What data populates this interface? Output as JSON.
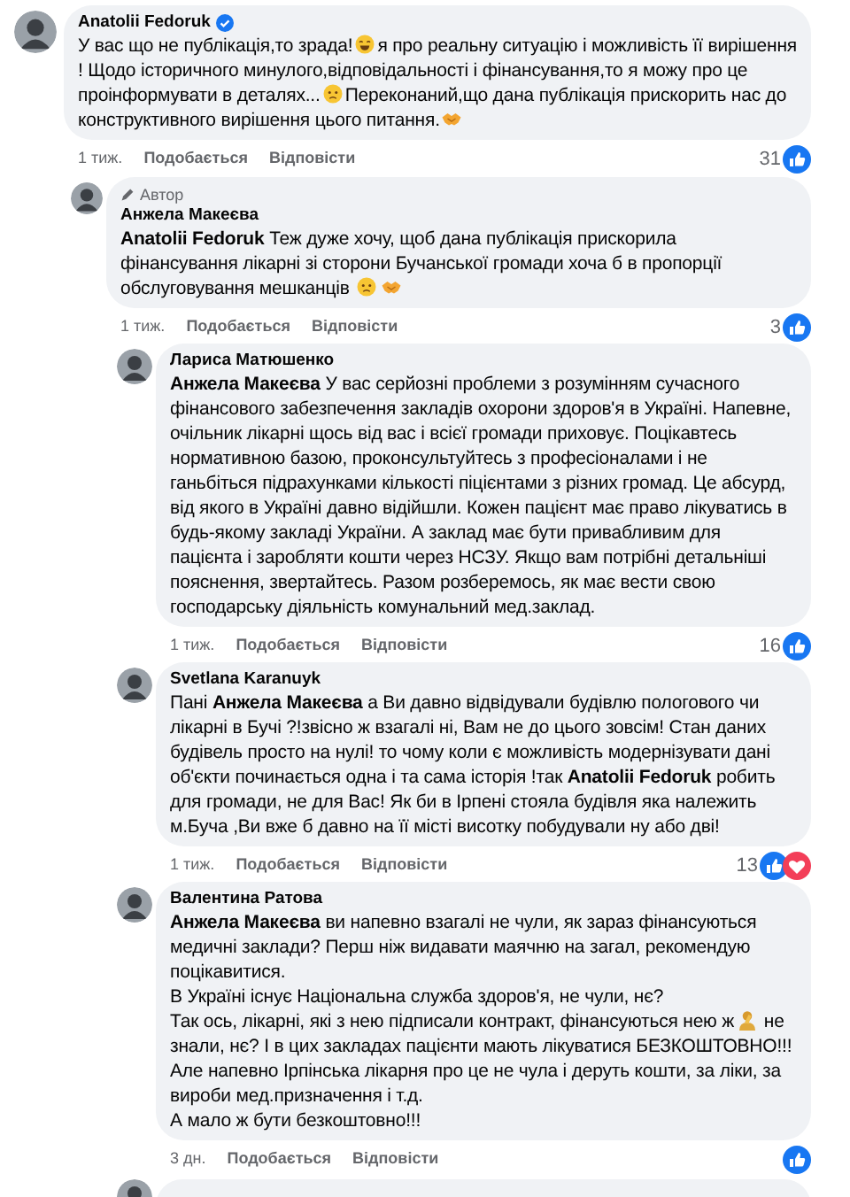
{
  "comments": [
    {
      "author": "Anatolii Fedoruk",
      "verified": true,
      "body": [
        {
          "kind": "text",
          "text": "У вас що не публікація,то зрада!"
        },
        {
          "kind": "grin"
        },
        {
          "kind": "text",
          "text": "я про реальну ситуацію і можливість її вирішення ! Щодо історичного минулого,відповідальності і фінансування,то я можу про це проінформувати в деталях..."
        },
        {
          "kind": "sad"
        },
        {
          "kind": "text",
          "text": "Переконаний,що дана публікація прискорить нас до конструктивного вирішення цього питання."
        },
        {
          "kind": "handshake"
        }
      ],
      "time": "1 тиж.",
      "like_label": "Подобається",
      "reply_label": "Відповісти",
      "reaction_count": "31",
      "reactions": [
        {
          "kind": "like"
        }
      ],
      "children": [
        {
          "author": "Анжела Макеєва",
          "badge": {
            "kind": "author",
            "text": "Автор"
          },
          "body": [
            {
              "kind": "mention",
              "text": "Anatolii Fedoruk"
            },
            {
              "kind": "text",
              "text": " Теж дуже хочу, щоб дана публікація прискорила фінансування лікарні зі сторони Бучанської громади хоча б в пропорції обслуговування мешканців "
            },
            {
              "kind": "sad"
            },
            {
              "kind": "handshake"
            }
          ],
          "time": "1 тиж.",
          "like_label": "Подобається",
          "reply_label": "Відповісти",
          "reaction_count": "3",
          "reactions": [
            {
              "kind": "like"
            }
          ],
          "children": [
            {
              "author": "Лариса Матюшенко",
              "body": [
                {
                  "kind": "mention",
                  "text": "Анжела Макеєва"
                },
                {
                  "kind": "text",
                  "text": " У вас серйозні проблеми з розумінням сучасного фінансового забезпечення закладів охорони здоров'я в Україні. Напевне, очільник лікарні щось від вас і всієї громади приховує. Поцікавтесь нормативною базою, проконсультуйтесь з професіоналами і не ганьбіться підрахунками кількості піцієнтами з різних громад. Це абсурд, від якого в Україні давно відійшли. Кожен пацієнт має право лікуватись в будь-якому закладі України. А заклад має бути привабливим для пацієнта і заробляти кошти через НСЗУ. Якщо вам потрібні детальніші пояснення, звертайтесь. Разом розберемось, як має вести свою господарську діяльність комунальний мед.заклад."
                }
              ],
              "time": "1 тиж.",
              "like_label": "Подобається",
              "reply_label": "Відповісти",
              "reaction_count": "16",
              "reactions": [
                {
                  "kind": "like"
                }
              ]
            },
            {
              "author": "Svetlana Karanuyk",
              "body": [
                {
                  "kind": "text",
                  "text": "Пані "
                },
                {
                  "kind": "mention",
                  "text": "Анжела Макеєва"
                },
                {
                  "kind": "text",
                  "text": " а Ви давно відвідували будівлю пологового чи лікарні в Бучі ?!звісно ж взагалі ні, Вам не до цього зовсім! Стан даних будівель просто на нулі! то чому коли є можливість модернізувати дані об'єкти починається одна і та сама історія !так "
                },
                {
                  "kind": "mention",
                  "text": "Anatolii Fedoruk"
                },
                {
                  "kind": "text",
                  "text": " робить для громади, не для Вас! Як би в Ірпені стояла будівля яка належить м.Буча ,Ви вже б давно на її місті висотку побудували ну або дві!"
                }
              ],
              "time": "1 тиж.",
              "like_label": "Подобається",
              "reply_label": "Відповісти",
              "reaction_count": "13",
              "reactions": [
                {
                  "kind": "like"
                },
                {
                  "kind": "love"
                }
              ]
            },
            {
              "author": "Валентина Ратова",
              "body": [
                {
                  "kind": "mention",
                  "text": "Анжела Макеєва"
                },
                {
                  "kind": "text",
                  "text": " ви напевно взагалі не чули, як зараз фінансуються медичні заклади? Перш ніж видавати маячню на загал, рекомендую поцікавитися.\nВ Україні існує Національна служба здоров'я, не чули, нє?\nТак ось, лікарні, які з нею підписали контракт, фінансуються нею ж"
                },
                {
                  "kind": "facepalm"
                },
                {
                  "kind": "text",
                  "text": " не знали, нє? І в цих закладах пацієнти мають лікуватися БЕЗКОШТОВНО!!!\nАле напевно Ірпінська лікарня про це не чула і деруть кошти, за ліки, за вироби мед.призначення і т.д.\nА мало ж бути безкоштовно!!!"
                }
              ],
              "time": "3 дн.",
              "like_label": "Подобається",
              "reply_label": "Відповісти",
              "reactions": [
                {
                  "kind": "like"
                }
              ]
            }
          ]
        }
      ]
    }
  ]
}
